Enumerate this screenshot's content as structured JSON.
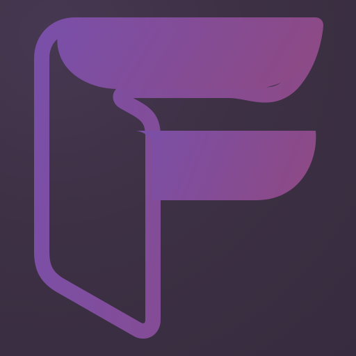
{
  "app_icon": {
    "icon_name": "letter-f-logo-icon",
    "colors": {
      "background": "#3d3044",
      "gradient_start": "#7a4fa8",
      "gradient_end": "#8c4a87"
    }
  }
}
